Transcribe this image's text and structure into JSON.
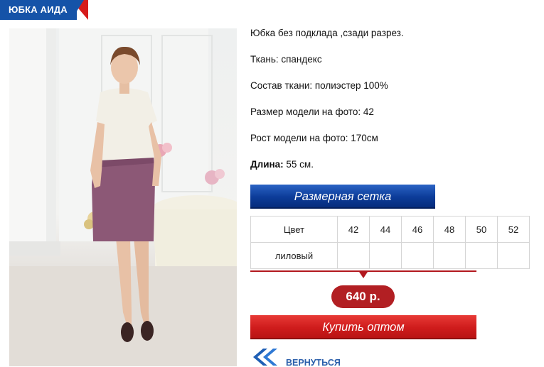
{
  "title": "ЮБКА АИДА",
  "product_image": {
    "alt": "Юбка Аида"
  },
  "description": {
    "line1": "Юбка без подклада ,сзади разрез.",
    "line2": "Ткань: спандекс",
    "line3": "Состав ткани: полиэстер 100%",
    "line4": "Размер модели на фото: 42",
    "line5": "Рост модели на фото: 170см",
    "length_label": "Длина:",
    "length_value": " 55 см."
  },
  "size_chart_button": "Размерная сетка",
  "size_table": {
    "header_label": "Цвет",
    "sizes": [
      "42",
      "44",
      "46",
      "48",
      "50",
      "52"
    ],
    "color_row": "лиловый"
  },
  "price": "640 р.",
  "buy_button": "Купить оптом",
  "back": {
    "label": "ВЕРНУТЬСЯ",
    "icon": "double-chevron-left-icon"
  },
  "colors": {
    "brand_blue": "#1553a8",
    "accent_red": "#b2181e"
  }
}
